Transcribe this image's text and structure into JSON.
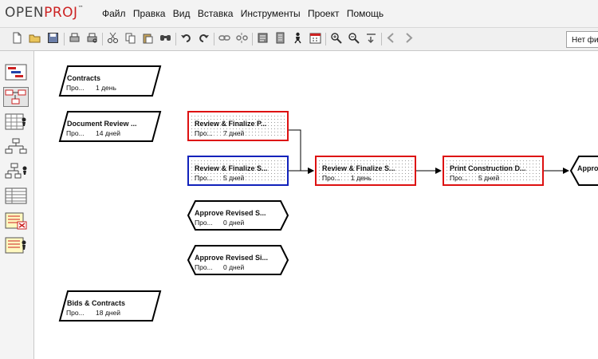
{
  "app": {
    "logo_open": "OPEN",
    "logo_proj": "PROJ",
    "logo_tm": "™"
  },
  "menu": {
    "items": [
      "Файл",
      "Правка",
      "Вид",
      "Вставка",
      "Инструменты",
      "Проект",
      "Помощь"
    ]
  },
  "toolbar": {
    "icons": [
      "new-icon",
      "open-icon",
      "save-icon",
      "print-icon",
      "print-preview-icon",
      "cut-icon",
      "copy-icon",
      "paste-icon",
      "find-icon",
      "undo-icon",
      "redo-icon",
      "link-icon",
      "unlink-icon",
      "task-info-icon",
      "notes-icon",
      "assign-resource-icon",
      "calendar-icon",
      "zoom-in-icon",
      "zoom-out-icon",
      "indent-icon",
      "back-icon",
      "forward-icon"
    ],
    "filter_value": "Нет фи"
  },
  "sidebar": {
    "views": [
      "gantt-view-icon",
      "network-view-icon",
      "resource-usage-icon",
      "wbs-icon",
      "rbs-icon",
      "task-usage-icon",
      "report-icon",
      "resource-report-icon"
    ],
    "active": "network-view-icon"
  },
  "network": {
    "nodes": [
      {
        "name": "Contracts",
        "prefix": "Про...",
        "duration": "1 день"
      },
      {
        "name": "Document Review ...",
        "prefix": "Про...",
        "duration": "14 дней"
      },
      {
        "name": "Review & Finalize P...",
        "prefix": "Про...",
        "duration": "7 дней"
      },
      {
        "name": "Review & Finalize S...",
        "prefix": "Про...",
        "duration": "5 дней"
      },
      {
        "name": "Review & Finalize S...",
        "prefix": "Про...",
        "duration": "1 день"
      },
      {
        "name": "Print Construction D...",
        "prefix": "Про...",
        "duration": "5 дней"
      },
      {
        "name": "Appro",
        "prefix": "",
        "duration": ""
      },
      {
        "name": "Approve Revised S...",
        "prefix": "Про...",
        "duration": "0 дней"
      },
      {
        "name": "Approve Revised Si...",
        "prefix": "Про...",
        "duration": "0 дней"
      },
      {
        "name": "Bids & Contracts",
        "prefix": "Про...",
        "duration": "18 дней"
      }
    ],
    "colors": {
      "critical": "#dd1111",
      "selected": "#1122bb",
      "normal": "#000000"
    }
  }
}
